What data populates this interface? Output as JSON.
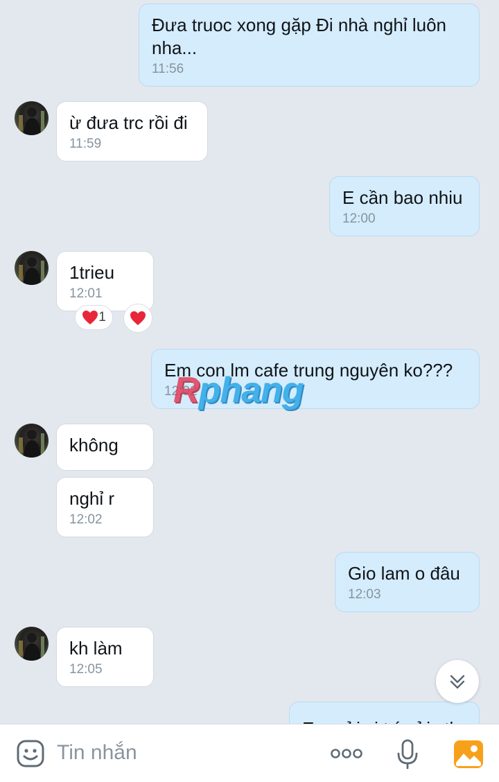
{
  "messages": [
    {
      "dir": "out",
      "text": "Đưa truoc xong gặp Đi nhà nghỉ luôn\nnha...",
      "time": "11:56"
    },
    {
      "dir": "in",
      "text": "ừ đưa trc rồi đi",
      "time": "11:59"
    },
    {
      "dir": "out",
      "text": "E cần bao nhiu",
      "time": "12:00"
    },
    {
      "dir": "in",
      "text": "1trieu",
      "time": "12:01",
      "reaction_count": "1"
    },
    {
      "dir": "out",
      "text": "Em con lm cafe trung nguyên ko???",
      "time": "12:02"
    },
    {
      "dir": "in",
      "text": "không",
      "time": ""
    },
    {
      "dir": "in",
      "text": "nghỉ r",
      "time": "12:02"
    },
    {
      "dir": "out",
      "text": "Gio lam o đâu",
      "time": "12:03"
    },
    {
      "dir": "in",
      "text": "kh làm",
      "time": "12:05"
    },
    {
      "dir": "out",
      "text": "Em gửi vị trí gửi stk",
      "time": ""
    }
  ],
  "watermark": {
    "r": "R",
    "rest": "phang"
  },
  "input": {
    "placeholder": "Tin nhắn"
  },
  "icons": {
    "emoji": "sticker-icon",
    "more": "more-icon",
    "mic": "microphone-icon",
    "gallery": "image-icon",
    "scroll": "chevron-double-down-icon",
    "reaction": "heart-icon"
  },
  "colors": {
    "outgoing": "#d4ecfc",
    "incoming": "#ffffff",
    "background": "#e3e8ee",
    "heart": "#e8263a"
  }
}
